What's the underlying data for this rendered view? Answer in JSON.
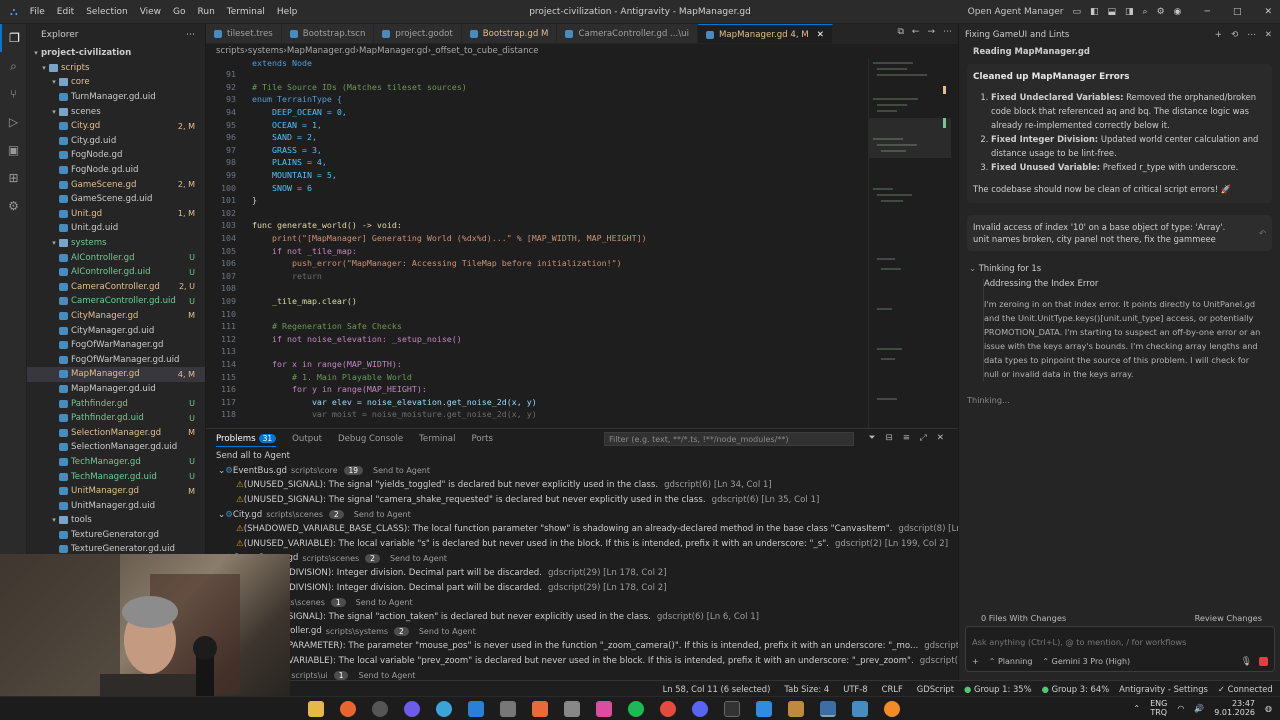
{
  "window": {
    "title": "project-civilization - Antigravity - MapManager.gd",
    "menu": [
      "File",
      "Edit",
      "Selection",
      "View",
      "Go",
      "Run",
      "Terminal",
      "Help"
    ],
    "open_agent_manager": "Open Agent Manager"
  },
  "explorer": {
    "title": "Explorer",
    "project": "project-civilization",
    "items": [
      {
        "label": "scripts",
        "type": "folder",
        "indent": 1,
        "badge": "",
        "color": "#e2c08d"
      },
      {
        "label": "core",
        "type": "folder",
        "indent": 2,
        "badge": "",
        "color": "#e2c08d"
      },
      {
        "label": "TurnManager.gd.uid",
        "type": "file",
        "indent": 3,
        "badge": "",
        "color": "#cccccc"
      },
      {
        "label": "scenes",
        "type": "folder",
        "indent": 2,
        "badge": "",
        "color": "#cccccc"
      },
      {
        "label": "City.gd",
        "type": "file",
        "indent": 3,
        "badge": "2, M",
        "color": "#e2c08d"
      },
      {
        "label": "City.gd.uid",
        "type": "file",
        "indent": 3,
        "badge": "",
        "color": "#cccccc"
      },
      {
        "label": "FogNode.gd",
        "type": "file",
        "indent": 3,
        "badge": "",
        "color": "#cccccc"
      },
      {
        "label": "FogNode.gd.uid",
        "type": "file",
        "indent": 3,
        "badge": "",
        "color": "#cccccc"
      },
      {
        "label": "GameScene.gd",
        "type": "file",
        "indent": 3,
        "badge": "2, M",
        "color": "#e2c08d"
      },
      {
        "label": "GameScene.gd.uid",
        "type": "file",
        "indent": 3,
        "badge": "",
        "color": "#cccccc"
      },
      {
        "label": "Unit.gd",
        "type": "file",
        "indent": 3,
        "badge": "1, M",
        "color": "#e2c08d"
      },
      {
        "label": "Unit.gd.uid",
        "type": "file",
        "indent": 3,
        "badge": "",
        "color": "#cccccc"
      },
      {
        "label": "systems",
        "type": "folder",
        "indent": 2,
        "badge": "",
        "color": "#73c991"
      },
      {
        "label": "AIController.gd",
        "type": "file",
        "indent": 3,
        "badge": "U",
        "color": "#73c991"
      },
      {
        "label": "AIController.gd.uid",
        "type": "file",
        "indent": 3,
        "badge": "U",
        "color": "#73c991"
      },
      {
        "label": "CameraController.gd",
        "type": "file",
        "indent": 3,
        "badge": "2, U",
        "color": "#e2c08d"
      },
      {
        "label": "CameraController.gd.uid",
        "type": "file",
        "indent": 3,
        "badge": "U",
        "color": "#73c991"
      },
      {
        "label": "CityManager.gd",
        "type": "file",
        "indent": 3,
        "badge": "M",
        "color": "#e2c08d"
      },
      {
        "label": "CityManager.gd.uid",
        "type": "file",
        "indent": 3,
        "badge": "",
        "color": "#cccccc"
      },
      {
        "label": "FogOfWarManager.gd",
        "type": "file",
        "indent": 3,
        "badge": "",
        "color": "#cccccc"
      },
      {
        "label": "FogOfWarManager.gd.uid",
        "type": "file",
        "indent": 3,
        "badge": "",
        "color": "#cccccc"
      },
      {
        "label": "MapManager.gd",
        "type": "file",
        "indent": 3,
        "badge": "4, M",
        "color": "#e2c08d",
        "selected": true
      },
      {
        "label": "MapManager.gd.uid",
        "type": "file",
        "indent": 3,
        "badge": "",
        "color": "#cccccc"
      },
      {
        "label": "Pathfinder.gd",
        "type": "file",
        "indent": 3,
        "badge": "U",
        "color": "#73c991"
      },
      {
        "label": "Pathfinder.gd.uid",
        "type": "file",
        "indent": 3,
        "badge": "U",
        "color": "#73c991"
      },
      {
        "label": "SelectionManager.gd",
        "type": "file",
        "indent": 3,
        "badge": "M",
        "color": "#e2c08d"
      },
      {
        "label": "SelectionManager.gd.uid",
        "type": "file",
        "indent": 3,
        "badge": "",
        "color": "#cccccc"
      },
      {
        "label": "TechManager.gd",
        "type": "file",
        "indent": 3,
        "badge": "U",
        "color": "#73c991"
      },
      {
        "label": "TechManager.gd.uid",
        "type": "file",
        "indent": 3,
        "badge": "U",
        "color": "#73c991"
      },
      {
        "label": "UnitManager.gd",
        "type": "file",
        "indent": 3,
        "badge": "M",
        "color": "#e2c08d"
      },
      {
        "label": "UnitManager.gd.uid",
        "type": "file",
        "indent": 3,
        "badge": "",
        "color": "#cccccc"
      },
      {
        "label": "tools",
        "type": "folder",
        "indent": 2,
        "badge": "",
        "color": "#cccccc"
      },
      {
        "label": "TextureGenerator.gd",
        "type": "file",
        "indent": 3,
        "badge": "",
        "color": "#cccccc"
      },
      {
        "label": "TextureGenerator.gd.uid",
        "type": "file",
        "indent": 3,
        "badge": "",
        "color": "#cccccc"
      }
    ]
  },
  "tabs": [
    {
      "label": "tileset.tres",
      "color": "#a0a0a0",
      "active": false
    },
    {
      "label": "Bootstrap.tscn",
      "color": "#a0a0a0",
      "active": false
    },
    {
      "label": "project.godot",
      "color": "#a0a0a0",
      "active": false
    },
    {
      "label": "Bootstrap.gd M",
      "color": "#e2c08d",
      "active": false
    },
    {
      "label": "CameraController.gd ...\\ui",
      "color": "#a0a0a0",
      "active": false
    },
    {
      "label": "MapManager.gd 4, M",
      "color": "#e2c08d",
      "active": true
    }
  ],
  "breadcrumbs": [
    "scripts",
    "systems",
    "MapManager.gd",
    "MapManager.gd",
    "_offset_to_cube_distance"
  ],
  "code": {
    "extends_line": "extends Node",
    "lines": [
      {
        "n": "91",
        "t": ""
      },
      {
        "n": "92",
        "t": "# Tile Source IDs (Matches tileset sources)",
        "c": "#6a9955"
      },
      {
        "n": "93",
        "t": "enum TerrainType {",
        "c": "#569cd6"
      },
      {
        "n": "94",
        "t": "    DEEP_OCEAN = 0,",
        "c": "#4fc1ff"
      },
      {
        "n": "95",
        "t": "    OCEAN = 1,",
        "c": "#4fc1ff"
      },
      {
        "n": "96",
        "t": "    SAND = 2,",
        "c": "#4fc1ff"
      },
      {
        "n": "97",
        "t": "    GRASS = 3,",
        "c": "#4fc1ff"
      },
      {
        "n": "98",
        "t": "    PLAINS = 4,",
        "c": "#4fc1ff"
      },
      {
        "n": "99",
        "t": "    MOUNTAIN = 5,",
        "c": "#4fc1ff"
      },
      {
        "n": "100",
        "t": "    SNOW = 6",
        "c": "#4fc1ff"
      },
      {
        "n": "101",
        "t": "}"
      },
      {
        "n": "102",
        "t": ""
      },
      {
        "n": "103",
        "t": "func generate_world() -> void:",
        "c": "#dcdcaa"
      },
      {
        "n": "104",
        "t": "    print(\"[MapManager] Generating World (%dx%d)...\" % [MAP_WIDTH, MAP_HEIGHT])",
        "c": "#ce9178"
      },
      {
        "n": "105",
        "t": "    if not _tile_map:",
        "c": "#c586c0"
      },
      {
        "n": "106",
        "t": "        push_error(\"MapManager: Accessing TileMap before initialization!\")",
        "c": "#ce9178"
      },
      {
        "n": "107",
        "t": "        return",
        "c": "#6e6e6e"
      },
      {
        "n": "108",
        "t": ""
      },
      {
        "n": "109",
        "t": "    _tile_map.clear()",
        "c": "#dcdcaa"
      },
      {
        "n": "110",
        "t": ""
      },
      {
        "n": "111",
        "t": "    # Regeneration Safe Checks",
        "c": "#6a9955"
      },
      {
        "n": "112",
        "t": "    if not noise_elevation: _setup_noise()",
        "c": "#c586c0"
      },
      {
        "n": "113",
        "t": ""
      },
      {
        "n": "114",
        "t": "    for x in range(MAP_WIDTH):",
        "c": "#c586c0"
      },
      {
        "n": "115",
        "t": "        # 1. Main Playable World",
        "c": "#6a9955"
      },
      {
        "n": "116",
        "t": "        for y in range(MAP_HEIGHT):",
        "c": "#c586c0"
      },
      {
        "n": "117",
        "t": "            var elev = noise_elevation.get_noise_2d(x, y)",
        "c": "#9cdcfe"
      },
      {
        "n": "118",
        "t": "            var moist = noise_moisture.get_noise_2d(x, y)",
        "c": "#6e6e6e"
      }
    ]
  },
  "panel": {
    "tabs": [
      "Problems",
      "Output",
      "Debug Console",
      "Terminal",
      "Ports"
    ],
    "problems_count": "31",
    "filter_placeholder": "Filter (e.g. text, **/*.ts, !**/node_modules/**)",
    "send_all": "Send all to Agent",
    "rows": [
      {
        "kind": "file",
        "text": "EventBus.gd",
        "sub": "scripts\\core",
        "count": "19",
        "ag": "Send to Agent"
      },
      {
        "kind": "warn",
        "text": "(UNUSED_SIGNAL): The signal \"yields_toggled\" is declared but never explicitly used in the class.",
        "loc": "gdscript(6)  [Ln 34, Col 1]"
      },
      {
        "kind": "warn",
        "text": "(UNUSED_SIGNAL): The signal \"camera_shake_requested\" is declared but never explicitly used in the class.",
        "loc": "gdscript(6)  [Ln 35, Col 1]"
      },
      {
        "kind": "file",
        "text": "City.gd",
        "sub": "scripts\\scenes",
        "count": "2",
        "ag": "Send to Agent"
      },
      {
        "kind": "warn",
        "text": "(SHADOWED_VARIABLE_BASE_CLASS): The local function parameter \"show\" is shadowing an already-declared method in the base class \"CanvasItem\".",
        "loc": "gdscript(8)  [Ln 173, Col 1]"
      },
      {
        "kind": "warn",
        "text": "(UNUSED_VARIABLE): The local variable \"s\" is declared but never used in the block. If this is intended, prefix it with an underscore: \"_s\".",
        "loc": "gdscript(2)  [Ln 199, Col 2]"
      },
      {
        "kind": "file",
        "text": "GameScene.gd",
        "sub": "scripts\\scenes",
        "count": "2",
        "ag": "Send to Agent"
      },
      {
        "kind": "warn",
        "text": "(INTEGER_DIVISION): Integer division. Decimal part will be discarded.",
        "loc": "gdscript(29)  [Ln 178, Col 2]"
      },
      {
        "kind": "warn",
        "text": "(INTEGER_DIVISION): Integer division. Decimal part will be discarded.",
        "loc": "gdscript(29)  [Ln 178, Col 2]"
      },
      {
        "kind": "file",
        "text": "Unit.gd",
        "sub": "scripts\\scenes",
        "count": "1",
        "ag": "Send to Agent"
      },
      {
        "kind": "warn",
        "text": "(UNUSED_SIGNAL): The signal \"action_taken\" is declared but never explicitly used in the class.",
        "loc": "gdscript(6)  [Ln 6, Col 1]"
      },
      {
        "kind": "file",
        "text": "CameraController.gd",
        "sub": "scripts\\systems",
        "count": "2",
        "ag": "Send to Agent"
      },
      {
        "kind": "warn",
        "text": "(UNUSED_PARAMETER): The parameter \"mouse_pos\" is never used in the function \"_zoom_camera()\". If this is intended, prefix it with an underscore: \"_mo...",
        "loc": "gdscript(5)  [Ln 83, Col 1]"
      },
      {
        "kind": "warn",
        "text": "(UNUSED_VARIABLE): The local variable \"prev_zoom\" is declared but never used in the block. If this is intended, prefix it with an underscore: \"_prev_zoom\".",
        "loc": "gdscript(2)  [Ln 85, Col 2]"
      },
      {
        "kind": "file",
        "text": "UnitPanel.gd",
        "sub": "scripts\\ui",
        "count": "1",
        "ag": "Send to Agent"
      }
    ]
  },
  "agent": {
    "header": "Fixing GameUI and Lints",
    "reading": "Reading MapManager.gd",
    "cleaned_title": "Cleaned up MapManager Errors",
    "fixes": [
      {
        "bold": "Fixed Undeclared Variables:",
        "text": "Removed the orphaned/broken code block that referenced aq and bq. The distance logic was already re-implemented correctly below it."
      },
      {
        "bold": "Fixed Integer Division:",
        "text": "Updated world center calculation and distance usage to be lint-free."
      },
      {
        "bold": "Fixed Unused Variable:",
        "text": "Prefixed r_type with underscore."
      }
    ],
    "summary": "The codebase should now be clean of critical script errors! 🚀",
    "user_msg_1": "Invalid access of index '10' on a base object of type: 'Array'.",
    "user_msg_2": "unit names broken, city panel not there, fix the gammeee",
    "thinking_label": "Thinking for 1s",
    "thought_title": "Addressing the Index Error",
    "thought_text": "I'm zeroing in on that index error. It points directly to UnitPanel.gd and the Unit.UnitType.keys()[unit.unit_type] access, or potentially PROMOTION_DATA. I'm starting to suspect an off-by-one error or an issue with the keys array's bounds. I'm checking array lengths and data types to pinpoint the source of this problem. I will check for null or invalid data in the keys array.",
    "thinking_dots": "Thinking...",
    "files_changes": "0 Files With Changes",
    "review": "Review Changes",
    "input_placeholder": "Ask anything (Ctrl+L), @ to mention, / for workflows",
    "mode": "Planning",
    "model": "Gemini 3 Pro (High)"
  },
  "status": {
    "pos": "Ln 58, Col 11 (6 selected)",
    "tab": "Tab Size: 4",
    "enc": "UTF-8",
    "eol": "CRLF",
    "lang": "GDScript",
    "group1": "Group 1: 35%",
    "group3": "Group 3: 64%",
    "settings": "Antigravity - Settings",
    "connected": "Connected"
  },
  "taskbar": {
    "lang1": "ENG",
    "lang2": "TRQ",
    "time": "23:47",
    "date": "9.01.2026"
  }
}
